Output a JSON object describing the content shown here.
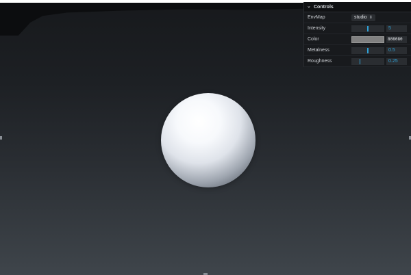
{
  "panel": {
    "title": "Controls",
    "rows": {
      "envmap": {
        "label": "EnvMap",
        "value": "studio"
      },
      "intensity": {
        "label": "Intensity",
        "value": "5",
        "level": 0.5
      },
      "color": {
        "label": "Color",
        "value": "808080",
        "swatch": "#808080"
      },
      "metalness": {
        "label": "Metalness",
        "value": "0.5",
        "level": 0.5
      },
      "roughness": {
        "label": "Roughness",
        "value": "0.25",
        "level": 0.25
      }
    }
  },
  "colors": {
    "accent": "#2fa1d6",
    "panel_bg": "#181a1d",
    "field_bg": "#2a2d31"
  },
  "icons": {
    "panel_toggle": "chevron-down-icon",
    "select_arrows": "up-down-arrows-icon"
  }
}
